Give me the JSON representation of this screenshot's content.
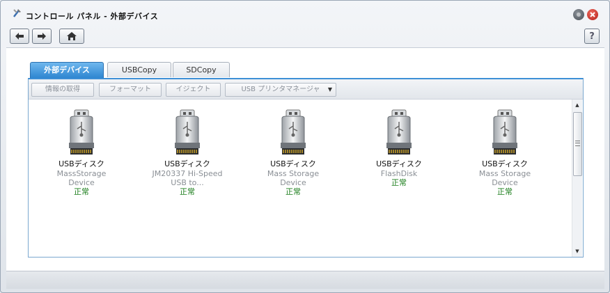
{
  "window": {
    "title": "コントロール パネル - 外部デバイス"
  },
  "toolbar": {
    "help_label": "?"
  },
  "tabs": [
    {
      "label": "外部デバイス",
      "active": true
    },
    {
      "label": "USBCopy",
      "active": false
    },
    {
      "label": "SDCopy",
      "active": false
    }
  ],
  "actions": {
    "get_info": "情報の取得",
    "format": "フォーマット",
    "eject": "イジェクト",
    "printer_manager": "USB プリンタマネージャ"
  },
  "devices": [
    {
      "name": "USBディスク",
      "desc1": "MassStorage",
      "desc2": "Device",
      "status": "正常"
    },
    {
      "name": "USBディスク",
      "desc1": "JM20337 Hi-Speed",
      "desc2": "USB to...",
      "status": "正常"
    },
    {
      "name": "USBディスク",
      "desc1": "Mass Storage",
      "desc2": "Device",
      "status": "正常"
    },
    {
      "name": "USBディスク",
      "desc1": "FlashDisk",
      "desc2": "",
      "status": "正常"
    },
    {
      "name": "USBディスク",
      "desc1": "Mass Storage",
      "desc2": "Device",
      "status": "正常"
    }
  ],
  "colors": {
    "active_tab": "#2e86d1",
    "status_ok": "#1a7d1a",
    "close_button": "#d0352c"
  }
}
